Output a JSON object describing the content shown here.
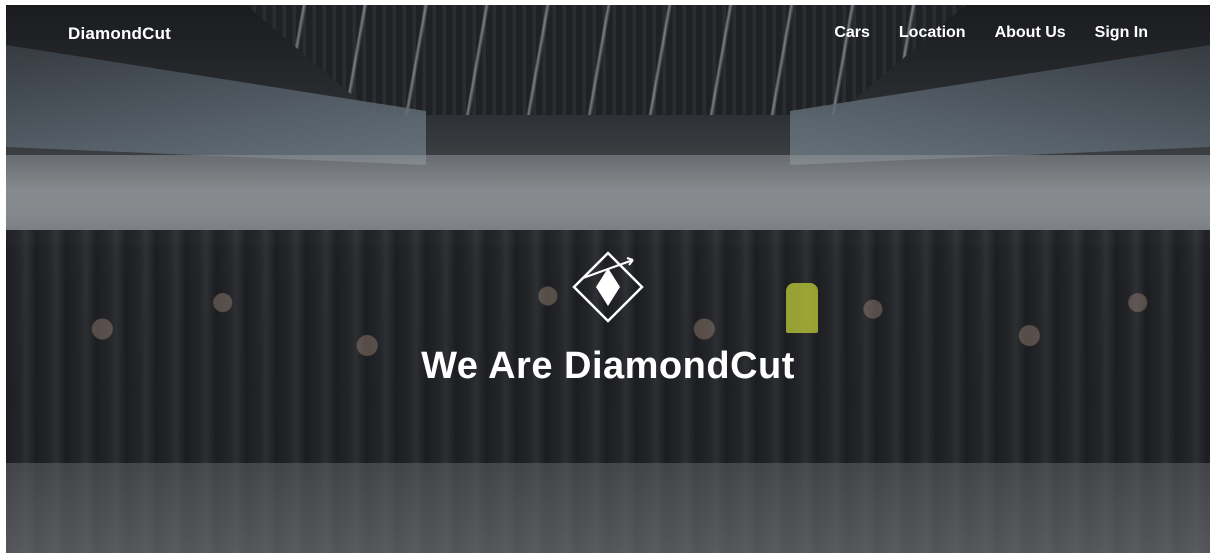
{
  "app": {
    "brand": "DiamondCut"
  },
  "nav": {
    "items": [
      {
        "label": "Cars"
      },
      {
        "label": "Location"
      },
      {
        "label": "About Us"
      },
      {
        "label": "Sign In"
      }
    ]
  },
  "hero": {
    "headline": "We Are DiamondCut",
    "emblem_icon": "diamond-emblem-icon",
    "background": "team-group-photo"
  },
  "colors": {
    "text": "#ffffff",
    "overlay": "#000000"
  }
}
